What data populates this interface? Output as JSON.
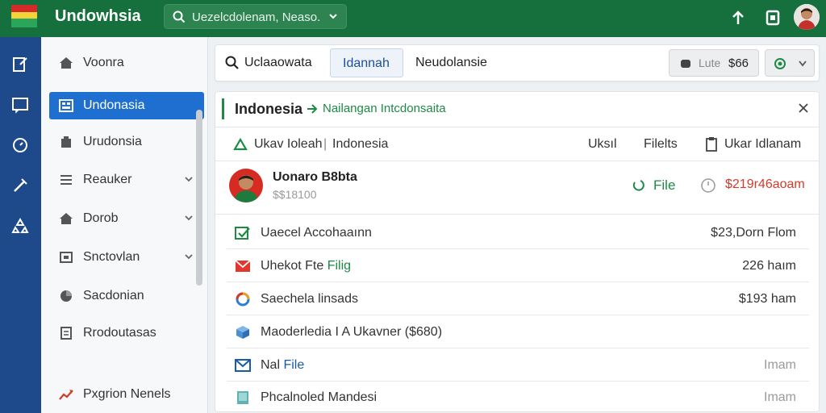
{
  "app": {
    "title": "Undowhsia",
    "search_text": "Uezelcdolenam, Neaso."
  },
  "sidebar": {
    "items": [
      {
        "label": "Voonra",
        "icon": "home-icon"
      },
      {
        "label": "Undonasia",
        "icon": "dashboard-icon",
        "active": true
      },
      {
        "label": "Urudonsia",
        "icon": "building-icon"
      },
      {
        "label": "Reauker",
        "icon": "list-icon",
        "expandable": true
      },
      {
        "label": "Dorob",
        "icon": "home-icon",
        "expandable": true
      },
      {
        "label": "Snctovlan",
        "icon": "box-icon",
        "expandable": true
      },
      {
        "label": "Sacdonian",
        "icon": "pie-icon"
      },
      {
        "label": "Rrodoutasas",
        "icon": "document-icon"
      },
      {
        "label": "Pxgrion Nenels",
        "icon": "chart-arrow-icon"
      }
    ]
  },
  "toolbar": {
    "search_label": "Uclaaowata",
    "active_tab": "Idannah",
    "tab_2": "Neudolansie",
    "balance_label": "Lute",
    "balance_value": "$66"
  },
  "panel": {
    "title": "Indonesia",
    "subtitle": "Nailangan Intcdonsaita",
    "info_left": "Ukav Ioleah",
    "info_separator": "|",
    "info_right": "Indonesia",
    "col_1": "Uksıl",
    "col_2": "Filelts",
    "col_3": "Ukar Idlanam",
    "person": {
      "name": "Uonaro B8bta",
      "amount": "$$18100",
      "file_label": "File",
      "due": "$219r46aoam"
    },
    "rows": [
      {
        "label": "Uaecel Accohaaınn",
        "value": "$23,Dorn Flom",
        "icon": "check-icon"
      },
      {
        "label_a": "Uhekot Fte ",
        "label_b": "Filig",
        "value": "226 haım",
        "icon": "mail-icon"
      },
      {
        "label": "Saechela linsads",
        "value": "$193 ham",
        "icon": "ring-icon"
      },
      {
        "label": "Maoderledia I A Ukavner ($680)",
        "value": "",
        "icon": "cube-icon"
      },
      {
        "label_a": "Nal ",
        "label_b": "File",
        "value": "Imam",
        "icon": "envelope-icon"
      },
      {
        "label": "Phcalnoled Mandesi",
        "value": "Imam",
        "icon": "tablet-icon"
      }
    ]
  },
  "colors": {
    "topbar": "#15703e",
    "rail": "#1e4a8c",
    "active": "#1f6fd1",
    "accent_green": "#1d8a45",
    "due_red": "#d23a2a"
  }
}
